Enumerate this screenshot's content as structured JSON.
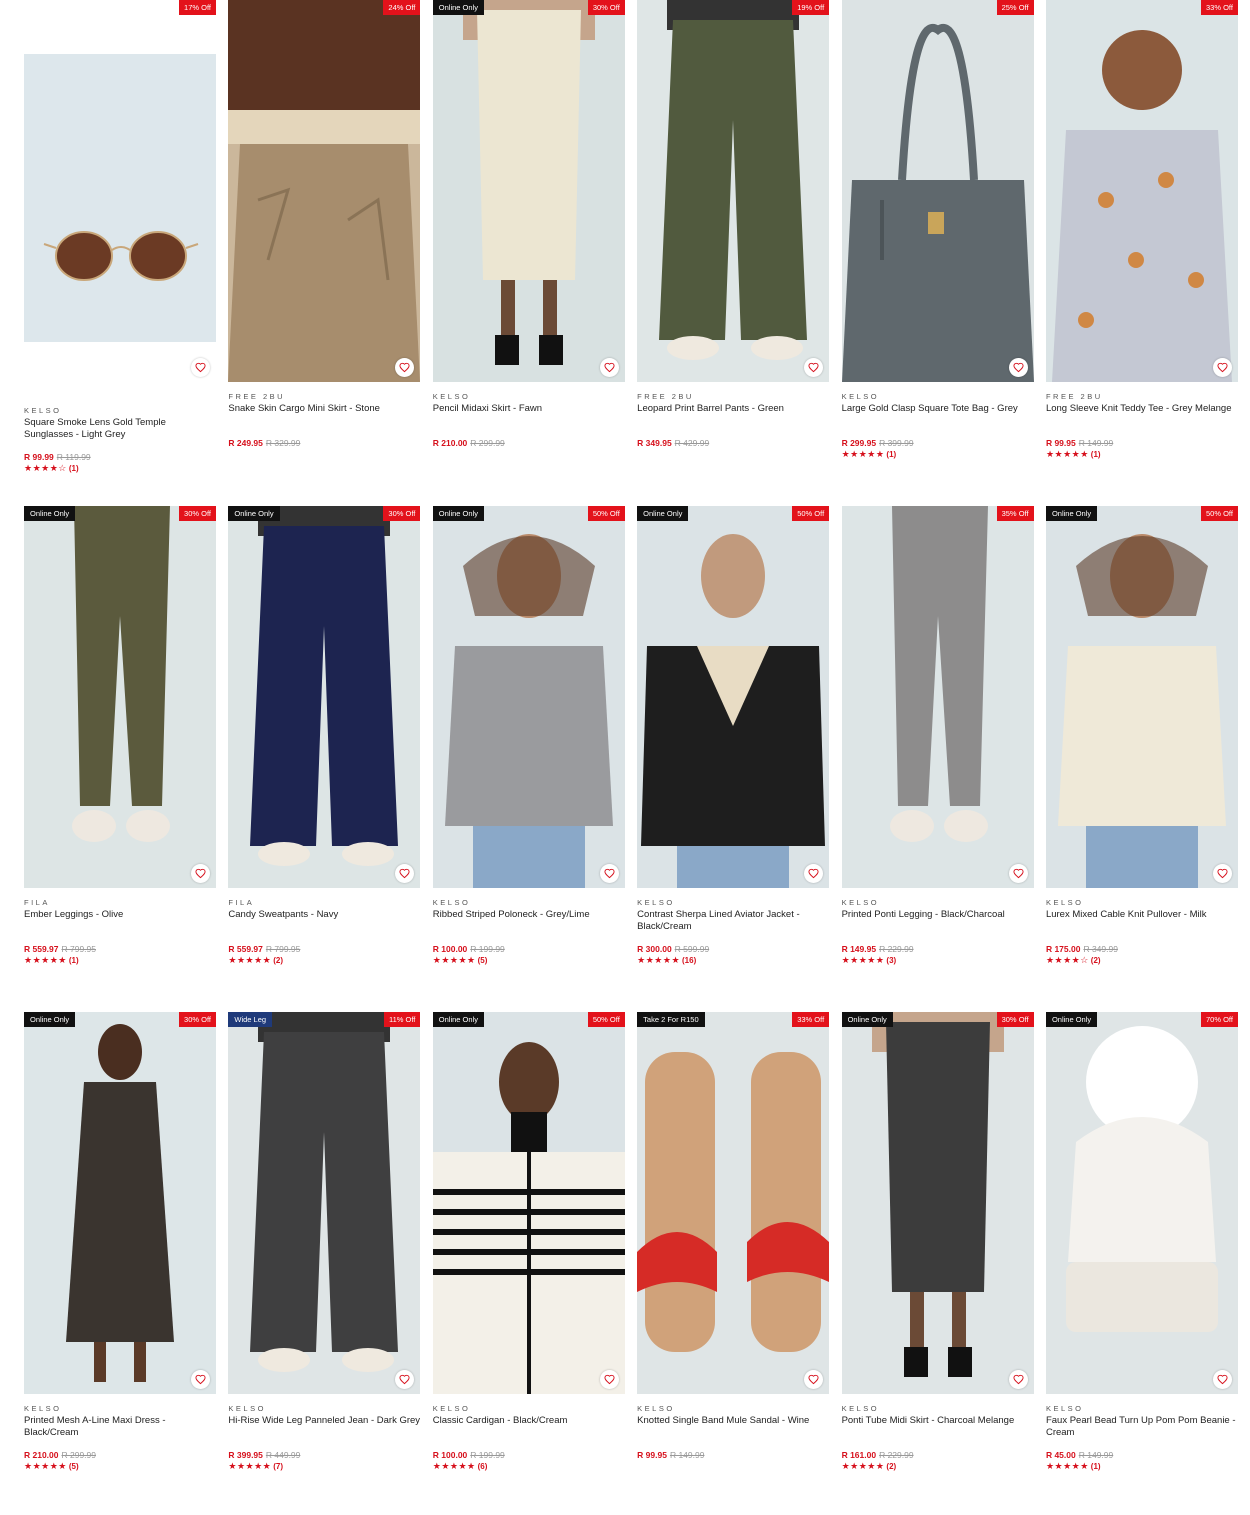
{
  "products": [
    {
      "brand": "KELSO",
      "name": "Square Smoke Lens Gold Temple Sunglasses - Light Grey",
      "price": "R 99.99",
      "was": "R 119.99",
      "discount": "17% Off",
      "badge": "",
      "rating": "★★★★☆",
      "reviews": "(1)",
      "bg": "#dde7ec",
      "figure": "sunglasses",
      "color": "#6b3a24"
    },
    {
      "brand": "FREE 2BU",
      "name": "Snake Skin Cargo Mini Skirt - Stone",
      "price": "R 249.95",
      "was": "R 329.99",
      "discount": "24% Off",
      "badge": "",
      "rating": "",
      "reviews": "",
      "bg": "#cbb79b",
      "figure": "skirt",
      "color": "#a78d6d"
    },
    {
      "brand": "KELSO",
      "name": "Pencil Midaxi Skirt - Fawn",
      "price": "R 210.00",
      "was": "R 299.99",
      "discount": "30% Off",
      "badge": "Online Only",
      "rating": "",
      "reviews": "",
      "bg": "#d8e1e1",
      "figure": "longskirt",
      "color": "#ece6d2"
    },
    {
      "brand": "FREE 2BU",
      "name": "Leopard Print Barrel Pants - Green",
      "price": "R 349.95",
      "was": "R 429.99",
      "discount": "19% Off",
      "badge": "",
      "rating": "",
      "reviews": "",
      "bg": "#dfe6e6",
      "figure": "pants",
      "color": "#515a3e"
    },
    {
      "brand": "KELSO",
      "name": "Large Gold Clasp Square Tote Bag - Grey",
      "price": "R 299.95",
      "was": "R 399.99",
      "discount": "25% Off",
      "badge": "",
      "rating": "★★★★★",
      "reviews": "(1)",
      "bg": "#dce3e4",
      "figure": "bag",
      "color": "#5f686d"
    },
    {
      "brand": "FREE 2BU",
      "name": "Long Sleeve Knit Teddy Tee - Grey Melange",
      "price": "R 99.95",
      "was": "R 149.99",
      "discount": "33% Off",
      "badge": "",
      "rating": "★★★★★",
      "reviews": "(1)",
      "bg": "#dbe4e6",
      "figure": "top",
      "color": "#c4c8d3"
    },
    {
      "brand": "FILA",
      "name": "Ember Leggings - Olive",
      "price": "R 559.97",
      "was": "R 799.95",
      "discount": "30% Off",
      "badge": "Online Only",
      "rating": "★★★★★",
      "reviews": "(1)",
      "bg": "#dde5e5",
      "figure": "leggings",
      "color": "#5b5a3d"
    },
    {
      "brand": "FILA",
      "name": "Candy Sweatpants - Navy",
      "price": "R 559.97",
      "was": "R 799.95",
      "discount": "30% Off",
      "badge": "Online Only",
      "rating": "★★★★★",
      "reviews": "(2)",
      "bg": "#dde5e5",
      "figure": "pants",
      "color": "#1d2450"
    },
    {
      "brand": "KELSO",
      "name": "Ribbed Striped Poloneck - Grey/Lime",
      "price": "R 100.00",
      "was": "R 199.99",
      "discount": "50% Off",
      "badge": "Online Only",
      "rating": "★★★★★",
      "reviews": "(5)",
      "bg": "#dbe3e6",
      "figure": "sweater",
      "color": "#9a9b9e"
    },
    {
      "brand": "KELSO",
      "name": "Contrast Sherpa Lined Aviator Jacket - Black/Cream",
      "price": "R 300.00",
      "was": "R 599.99",
      "discount": "50% Off",
      "badge": "Online Only",
      "rating": "★★★★★",
      "reviews": "(16)",
      "bg": "#dbe3e6",
      "figure": "jacket",
      "color": "#1e1e1e"
    },
    {
      "brand": "KELSO",
      "name": "Printed Ponti Legging - Black/Charcoal",
      "price": "R 149.95",
      "was": "R 229.99",
      "discount": "35% Off",
      "badge": "",
      "rating": "★★★★★",
      "reviews": "(3)",
      "bg": "#dde5e6",
      "figure": "leggings",
      "color": "#8d8c8c"
    },
    {
      "brand": "KELSO",
      "name": "Lurex Mixed Cable Knit Pullover - Milk",
      "price": "R 175.00",
      "was": "R 349.99",
      "discount": "50% Off",
      "badge": "Online Only",
      "rating": "★★★★☆",
      "reviews": "(2)",
      "bg": "#dbe3e6",
      "figure": "sweater",
      "color": "#efe9d8"
    },
    {
      "brand": "KELSO",
      "name": "Printed Mesh A-Line Maxi Dress - Black/Cream",
      "price": "R 210.00",
      "was": "R 299.99",
      "discount": "30% Off",
      "badge": "Online Only",
      "rating": "★★★★★",
      "reviews": "(5)",
      "bg": "#dde6e8",
      "figure": "dress",
      "color": "#3a342f"
    },
    {
      "brand": "KELSO",
      "name": "Hi-Rise Wide Leg Panneled Jean - Dark Grey",
      "price": "R 399.95",
      "was": "R 449.99",
      "discount": "11% Off",
      "badge": "Wide Leg",
      "rating": "★★★★★",
      "reviews": "(7)",
      "bg": "#dfe5e6",
      "figure": "pants",
      "color": "#3f3f40"
    },
    {
      "brand": "KELSO",
      "name": "Classic Cardigan - Black/Cream",
      "price": "R 100.00",
      "was": "R 199.99",
      "discount": "50% Off",
      "badge": "Online Only",
      "rating": "★★★★★",
      "reviews": "(6)",
      "bg": "#dbe3e6",
      "figure": "cardigan",
      "color": "#f3f0e8"
    },
    {
      "brand": "KELSO",
      "name": "Knotted Single Band Mule Sandal - Wine",
      "price": "R 99.95",
      "was": "R 149.99",
      "discount": "33% Off",
      "badge": "Take 2 For R150",
      "rating": "",
      "reviews": "",
      "bg": "#dfe5e6",
      "figure": "sandals",
      "color": "#d62b26"
    },
    {
      "brand": "KELSO",
      "name": "Ponti Tube Midi Skirt - Charcoal Melange",
      "price": "R 161.00",
      "was": "R 229.99",
      "discount": "30% Off",
      "badge": "Online Only",
      "rating": "★★★★★",
      "reviews": "(2)",
      "bg": "#dfe5e6",
      "figure": "longskirt",
      "color": "#3c3c3c"
    },
    {
      "brand": "KELSO",
      "name": "Faux Pearl Bead Turn Up Pom Pom Beanie - Cream",
      "price": "R 45.00",
      "was": "R 149.99",
      "discount": "70% Off",
      "badge": "Online Only",
      "rating": "★★★★★",
      "reviews": "(1)",
      "bg": "#dfe5e6",
      "figure": "beanie",
      "color": "#f4f2ee"
    }
  ]
}
